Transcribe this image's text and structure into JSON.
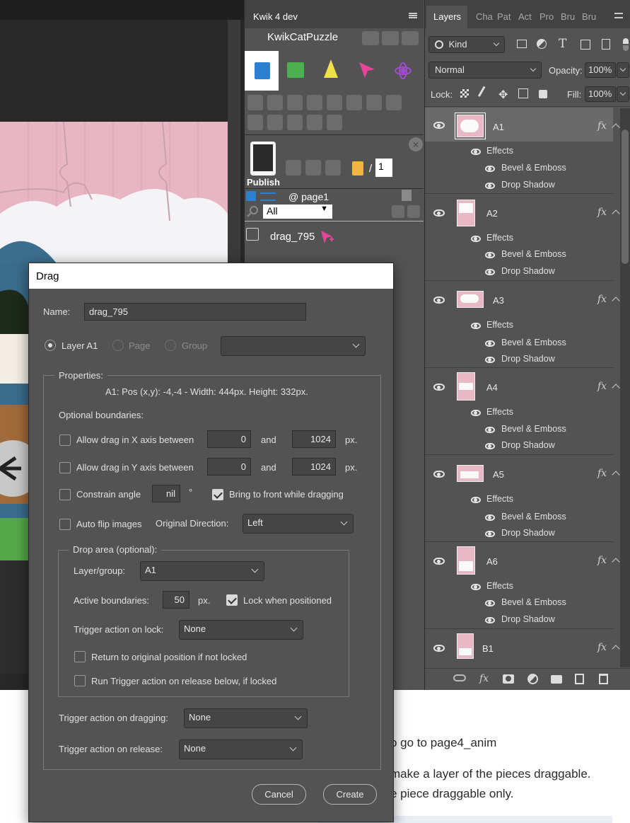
{
  "kwik_panel": {
    "tab_title": "Kwik 4 dev",
    "project_name": "KwikCatPuzzle",
    "publish_label": "Publish",
    "page_counter": {
      "separator": "/",
      "value": "1"
    },
    "page_title": "@ page1",
    "filter_value": "All",
    "list_item": "drag_795"
  },
  "layers_panel": {
    "tabs": [
      "Layers",
      "Cha",
      "Pat",
      "Act",
      "Pro",
      "Bru",
      "Bru"
    ],
    "filter_kind": "Kind",
    "blend_mode": "Normal",
    "opacity_label": "Opacity:",
    "opacity_value": "100%",
    "lock_label": "Lock:",
    "fill_label": "Fill:",
    "fill_value": "100%",
    "effects_label": "Effects",
    "bevel_label": "Bevel & Emboss",
    "shadow_label": "Drop Shadow",
    "fx_label": "fx",
    "layers": [
      {
        "name": "A1"
      },
      {
        "name": "A2"
      },
      {
        "name": "A3"
      },
      {
        "name": "A4"
      },
      {
        "name": "A5"
      },
      {
        "name": "A6"
      },
      {
        "name": "B1"
      }
    ],
    "bottom_fx": "fx"
  },
  "dialog": {
    "title": "Drag",
    "name_label": "Name:",
    "name_value": "drag_795",
    "radio_layer": "Layer A1",
    "radio_page": "Page",
    "radio_group": "Group",
    "properties_label": "Properties:",
    "properties_info": "A1: Pos (x,y): -4,-4 - Width: 444px. Height: 332px.",
    "optional_boundaries": "Optional boundaries:",
    "allow_x_label": "Allow drag in X axis between",
    "allow_x_min": "0",
    "allow_x_max": "1024",
    "allow_y_label": "Allow drag in Y axis between",
    "allow_y_min": "0",
    "allow_y_max": "1024",
    "and_label": "and",
    "px_label": "px.",
    "constrain_label": "Constrain angle",
    "constrain_value": "nil",
    "degree_symbol": "°",
    "bring_front_label": "Bring to front while dragging",
    "auto_flip_label": "Auto flip images",
    "original_direction_label": "Original Direction:",
    "original_direction_value": "Left",
    "drop_area_label": "Drop area (optional):",
    "layer_group_label": "Layer/group:",
    "layer_group_value": "A1",
    "active_boundaries_label": "Active boundaries:",
    "active_boundaries_value": "50",
    "active_px": "px.",
    "lock_positioned_label": "Lock when positioned",
    "trigger_lock_label": "Trigger action on lock:",
    "trigger_lock_value": "None",
    "return_label": "Return to original position if not locked",
    "run_trigger_label": "Run Trigger action on release below, if locked",
    "trigger_dragging_label": "Trigger action on dragging:",
    "trigger_dragging_value": "None",
    "trigger_release_label": "Trigger action on release:",
    "trigger_release_value": "None",
    "cancel": "Cancel",
    "create": "Create"
  },
  "background_doc": {
    "line1": "o go to page4_anim",
    "line2": "make a layer of the pieces draggable.",
    "line3": "e piece draggable only."
  }
}
